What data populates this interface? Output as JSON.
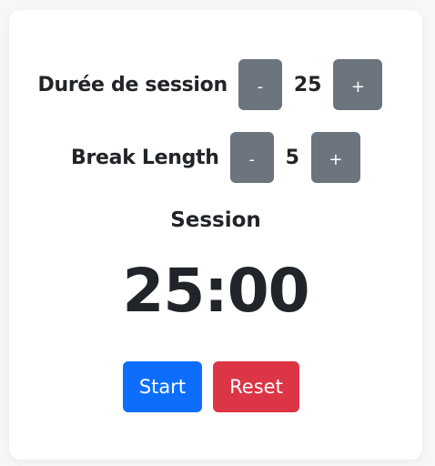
{
  "session_length": {
    "label": "Durée de session",
    "value": "25",
    "decrement": "-",
    "increment": "+"
  },
  "break_length": {
    "label": "Break Length",
    "value": "5",
    "decrement": "-",
    "increment": "+"
  },
  "timer": {
    "label": "Session",
    "display": "25:00"
  },
  "controls": {
    "start": "Start",
    "reset": "Reset"
  },
  "colors": {
    "secondary": "#6c757d",
    "primary": "#0d6efd",
    "danger": "#dc3545"
  }
}
